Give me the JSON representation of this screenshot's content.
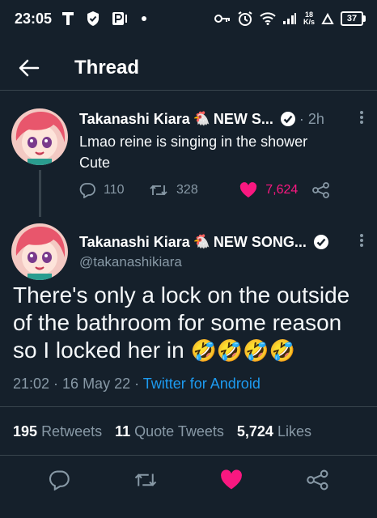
{
  "status_bar": {
    "time": "23:05",
    "net_speed_value": "18",
    "net_speed_unit": "K/s",
    "battery": "37"
  },
  "header": {
    "title": "Thread"
  },
  "tweet1": {
    "name": "Takanashi Kiara",
    "rooster": "🐔",
    "name_suffix": "NEW S...",
    "time": "· 2h",
    "text_line1": "Lmao reine is singing in the shower",
    "text_line2": "Cute",
    "replies": "110",
    "retweets": "328",
    "likes": "7,624"
  },
  "tweet2": {
    "name": "Takanashi Kiara",
    "rooster": "🐔",
    "name_suffix": "NEW SONG...",
    "handle": "@takanashikiara",
    "text": "There's only a lock on the outside of the bathroom for some reason so I locked her in",
    "emoji": "🤣🤣🤣🤣",
    "timestamp": "21:02 · 16 May 22 · ",
    "source": "Twitter for Android"
  },
  "stats": {
    "retweets_count": "195",
    "retweets_label": "Retweets",
    "quotes_count": "11",
    "quotes_label": "Quote Tweets",
    "likes_count": "5,724",
    "likes_label": "Likes"
  },
  "colors": {
    "background": "#15202b",
    "accent": "#1d9bf0",
    "like": "#f91880",
    "muted": "#8899a6"
  }
}
